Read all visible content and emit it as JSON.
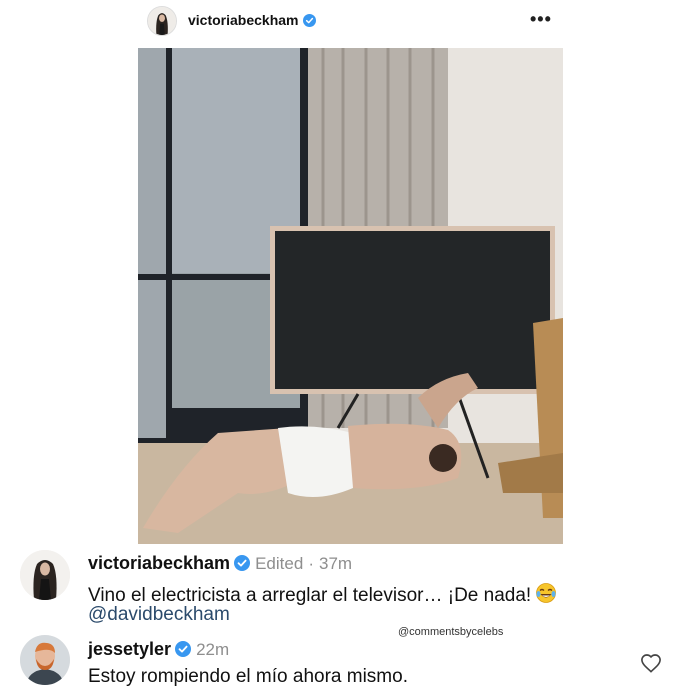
{
  "header": {
    "username": "victoriabeckham",
    "more_label": "•••"
  },
  "post_image": {
    "description_icon": "photo-placeholder"
  },
  "comments": [
    {
      "username": "victoriabeckham",
      "edited": "Edited",
      "separator": "·",
      "time": "37m",
      "text": "Vino el electricista a arreglar el televisor… ¡De nada!",
      "emoji": "laughing-tears-emoji",
      "mention": "@davidbeckham"
    },
    {
      "username": "jessetyler",
      "time": "22m",
      "text": "Estoy rompiendo el mío ahora mismo."
    }
  ],
  "watermark": "@commentsbycelebs",
  "colors": {
    "verified": "#3897f0",
    "mention": "#2b4a6b",
    "secondary": "#8e8e8e"
  }
}
